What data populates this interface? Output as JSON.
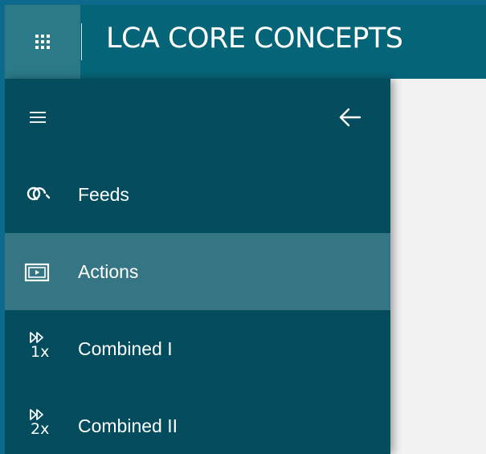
{
  "header": {
    "title": "LCA CORE CONCEPTS",
    "apps_icon": "app-launcher-waffle-icon"
  },
  "sidebar": {
    "menu_icon": "hamburger-menu-icon",
    "collapse_icon": "back-arrow-icon",
    "active_index": 1,
    "items": [
      {
        "label": "Feeds",
        "icon": "feeds-link-icon"
      },
      {
        "label": "Actions",
        "icon": "actions-play-icon"
      },
      {
        "label": "Combined I",
        "icon": "fast-forward-1x-icon",
        "multiplier": "1x"
      },
      {
        "label": "Combined II",
        "icon": "fast-forward-2x-icon",
        "multiplier": "2x"
      }
    ]
  },
  "colors": {
    "outer_border": "#0e6a8c",
    "topbar": "#056578",
    "waffle_bg": "#2b7a88",
    "sidebar": "#024c5e",
    "active_item": "#367684",
    "content_bg": "#f2f2f2"
  }
}
